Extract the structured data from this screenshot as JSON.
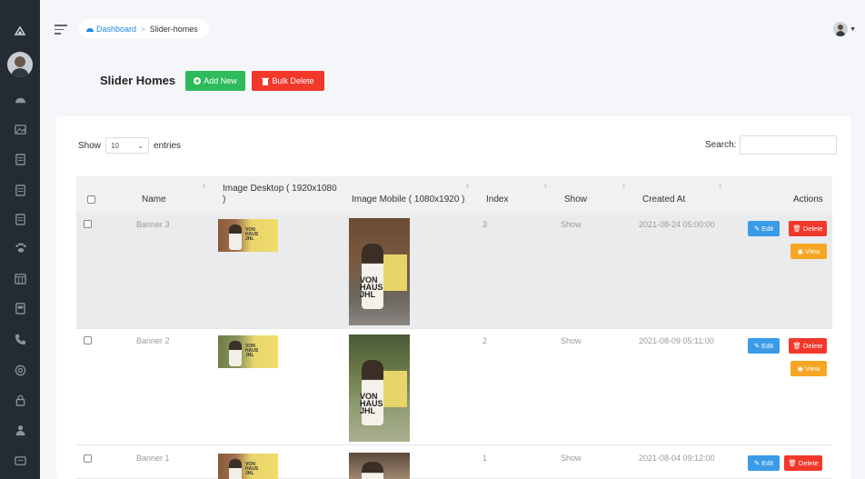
{
  "breadcrumb": {
    "home": "Dashboard",
    "current": "Slider-homes"
  },
  "page": {
    "title": "Slider Homes",
    "add_label": "Add New",
    "bulk_label": "Bulk Delete"
  },
  "table_controls": {
    "show": "Show",
    "entries_value": "10",
    "entries": "entries",
    "search_label": "Search:"
  },
  "columns": {
    "name": "Name",
    "image_desktop": "Image Desktop ( 1920x1080 )",
    "image_mobile": "Image Mobile ( 1080x1920 )",
    "index": "Index",
    "show": "Show",
    "created_at": "Created At",
    "actions": "Actions"
  },
  "thumb_text": {
    "line1": "VON",
    "line2": "HAUS",
    "line3": "JHL"
  },
  "rows": [
    {
      "name": "Banner 3",
      "index": "3",
      "show": "Show",
      "created_at": "2021-08-24 05:00:00"
    },
    {
      "name": "Banner 2",
      "index": "2",
      "show": "Show",
      "created_at": "2021-08-09 05:11:00"
    },
    {
      "name": "Banner 1",
      "index": "1",
      "show": "Show",
      "created_at": "2021-08-04 09:12:00"
    }
  ],
  "actions": {
    "edit": "Edit",
    "delete": "Delete",
    "view": "View"
  },
  "colors": {
    "sidebar": "#252b33",
    "success": "#2dbb5c",
    "danger": "#f2382b",
    "info": "#3a9be8",
    "warning": "#f6a623",
    "link": "#1e88e5"
  },
  "sidebar_icons": [
    "logo-icon",
    "dashboard-icon",
    "image-icon",
    "document-icon",
    "document-icon",
    "document-icon",
    "paw-icon",
    "calendar-icon",
    "file-icon",
    "phone-icon",
    "support-icon",
    "lock-icon",
    "user-icon",
    "message-icon"
  ]
}
